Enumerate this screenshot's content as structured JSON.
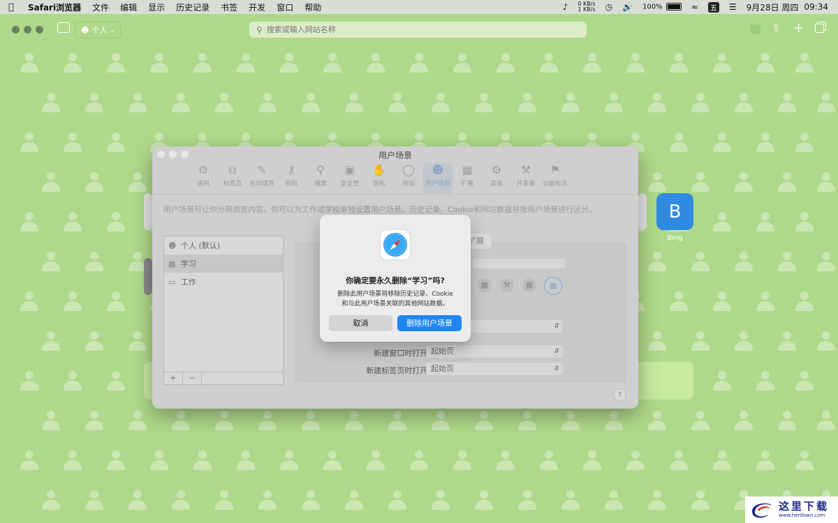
{
  "menubar": {
    "app_name": "Safari浏览器",
    "items": [
      "文件",
      "编辑",
      "显示",
      "历史记录",
      "书签",
      "开发",
      "窗口",
      "帮助"
    ],
    "net_up": "0 KB/s",
    "net_down": "1 KB/s",
    "battery": "100%",
    "ime": "五",
    "date": "9月28日 周四",
    "time": "09:34"
  },
  "toolbar": {
    "profile_label": "个人",
    "search_placeholder": "搜索或输入网站名称"
  },
  "start_page": {
    "bing_letter": "B",
    "bing_label": "Bing"
  },
  "prefs": {
    "title": "用户场景",
    "tabs": [
      "通用",
      "标签页",
      "自动填充",
      "密码",
      "搜索",
      "安全性",
      "隐私",
      "网站",
      "用户场景",
      "扩展",
      "高级",
      "开发者",
      "功能标志"
    ],
    "active_tab": 8,
    "description": "用户场景可让你分隔浏览内容。你可以为工作或学校单独设置用户场景。历史记录、Cookie和网站数据将按用户场景进行区分。",
    "profiles": [
      {
        "name": "个人 (默认)",
        "icon": "person-icon"
      },
      {
        "name": "学习",
        "icon": "chart-icon"
      },
      {
        "name": "工作",
        "icon": "monitor-icon"
      }
    ],
    "selected_profile": 1,
    "list_add": "+",
    "list_remove": "−",
    "ext_tab": "扩展",
    "new_window_label": "新建窗口时打开:",
    "new_window_value": "起始页",
    "new_tab_label": "新建标签页时打开:",
    "new_tab_value": "起始页",
    "help": "?"
  },
  "alert": {
    "title": "你确定要永久删除“学习”吗?",
    "message_line1": "删除此用户场景将移除历史记录、Cookie",
    "message_line2": "和与此用户场景关联的其他网站数据。",
    "cancel_label": "取消",
    "delete_label": "删除用户场景"
  },
  "watermark": {
    "title": "这里下载",
    "url": "www.herdown.com"
  }
}
